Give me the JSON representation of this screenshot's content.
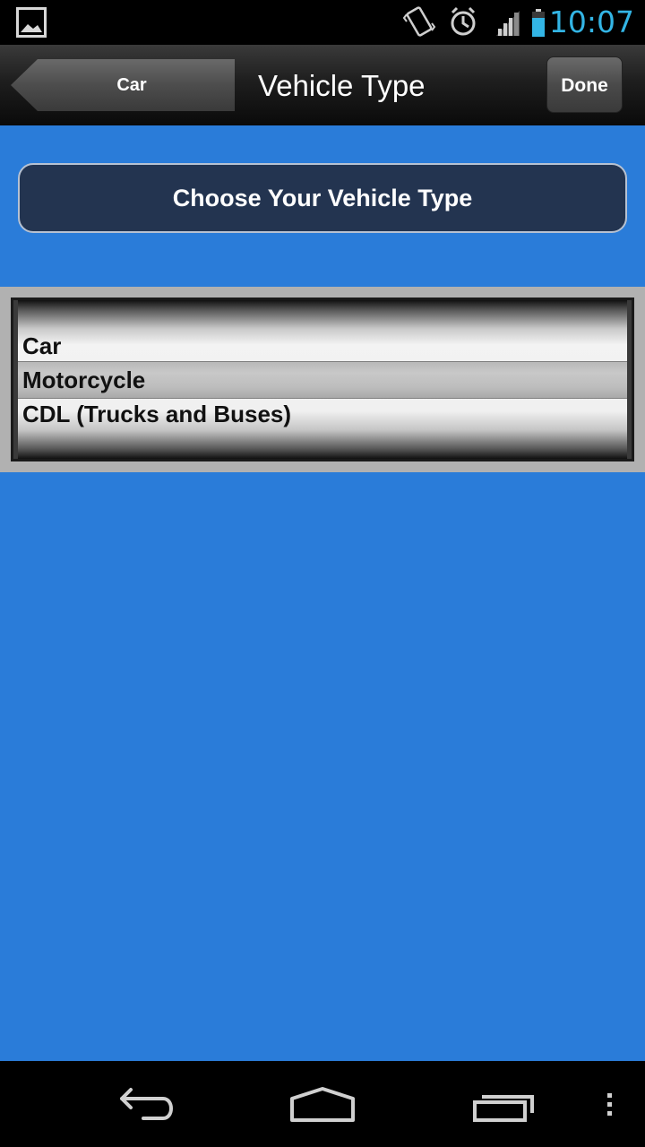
{
  "status_bar": {
    "time": "10:07",
    "icons": [
      "gallery-icon",
      "vibrate-icon",
      "alarm-icon",
      "signal-icon",
      "battery-icon"
    ],
    "time_color": "#33b5e5"
  },
  "action_bar": {
    "back_label": "Car",
    "title": "Vehicle Type",
    "done_label": "Done"
  },
  "main": {
    "choose_label": "Choose Your Vehicle Type",
    "background_color": "#2a7cd9"
  },
  "picker": {
    "options": [
      "Car",
      "Motorcycle",
      "CDL (Trucks and Buses)"
    ],
    "selected": "Motorcycle"
  },
  "nav_bar": {
    "buttons": [
      "back-icon",
      "home-icon",
      "recent-apps-icon",
      "overflow-menu-icon"
    ]
  }
}
